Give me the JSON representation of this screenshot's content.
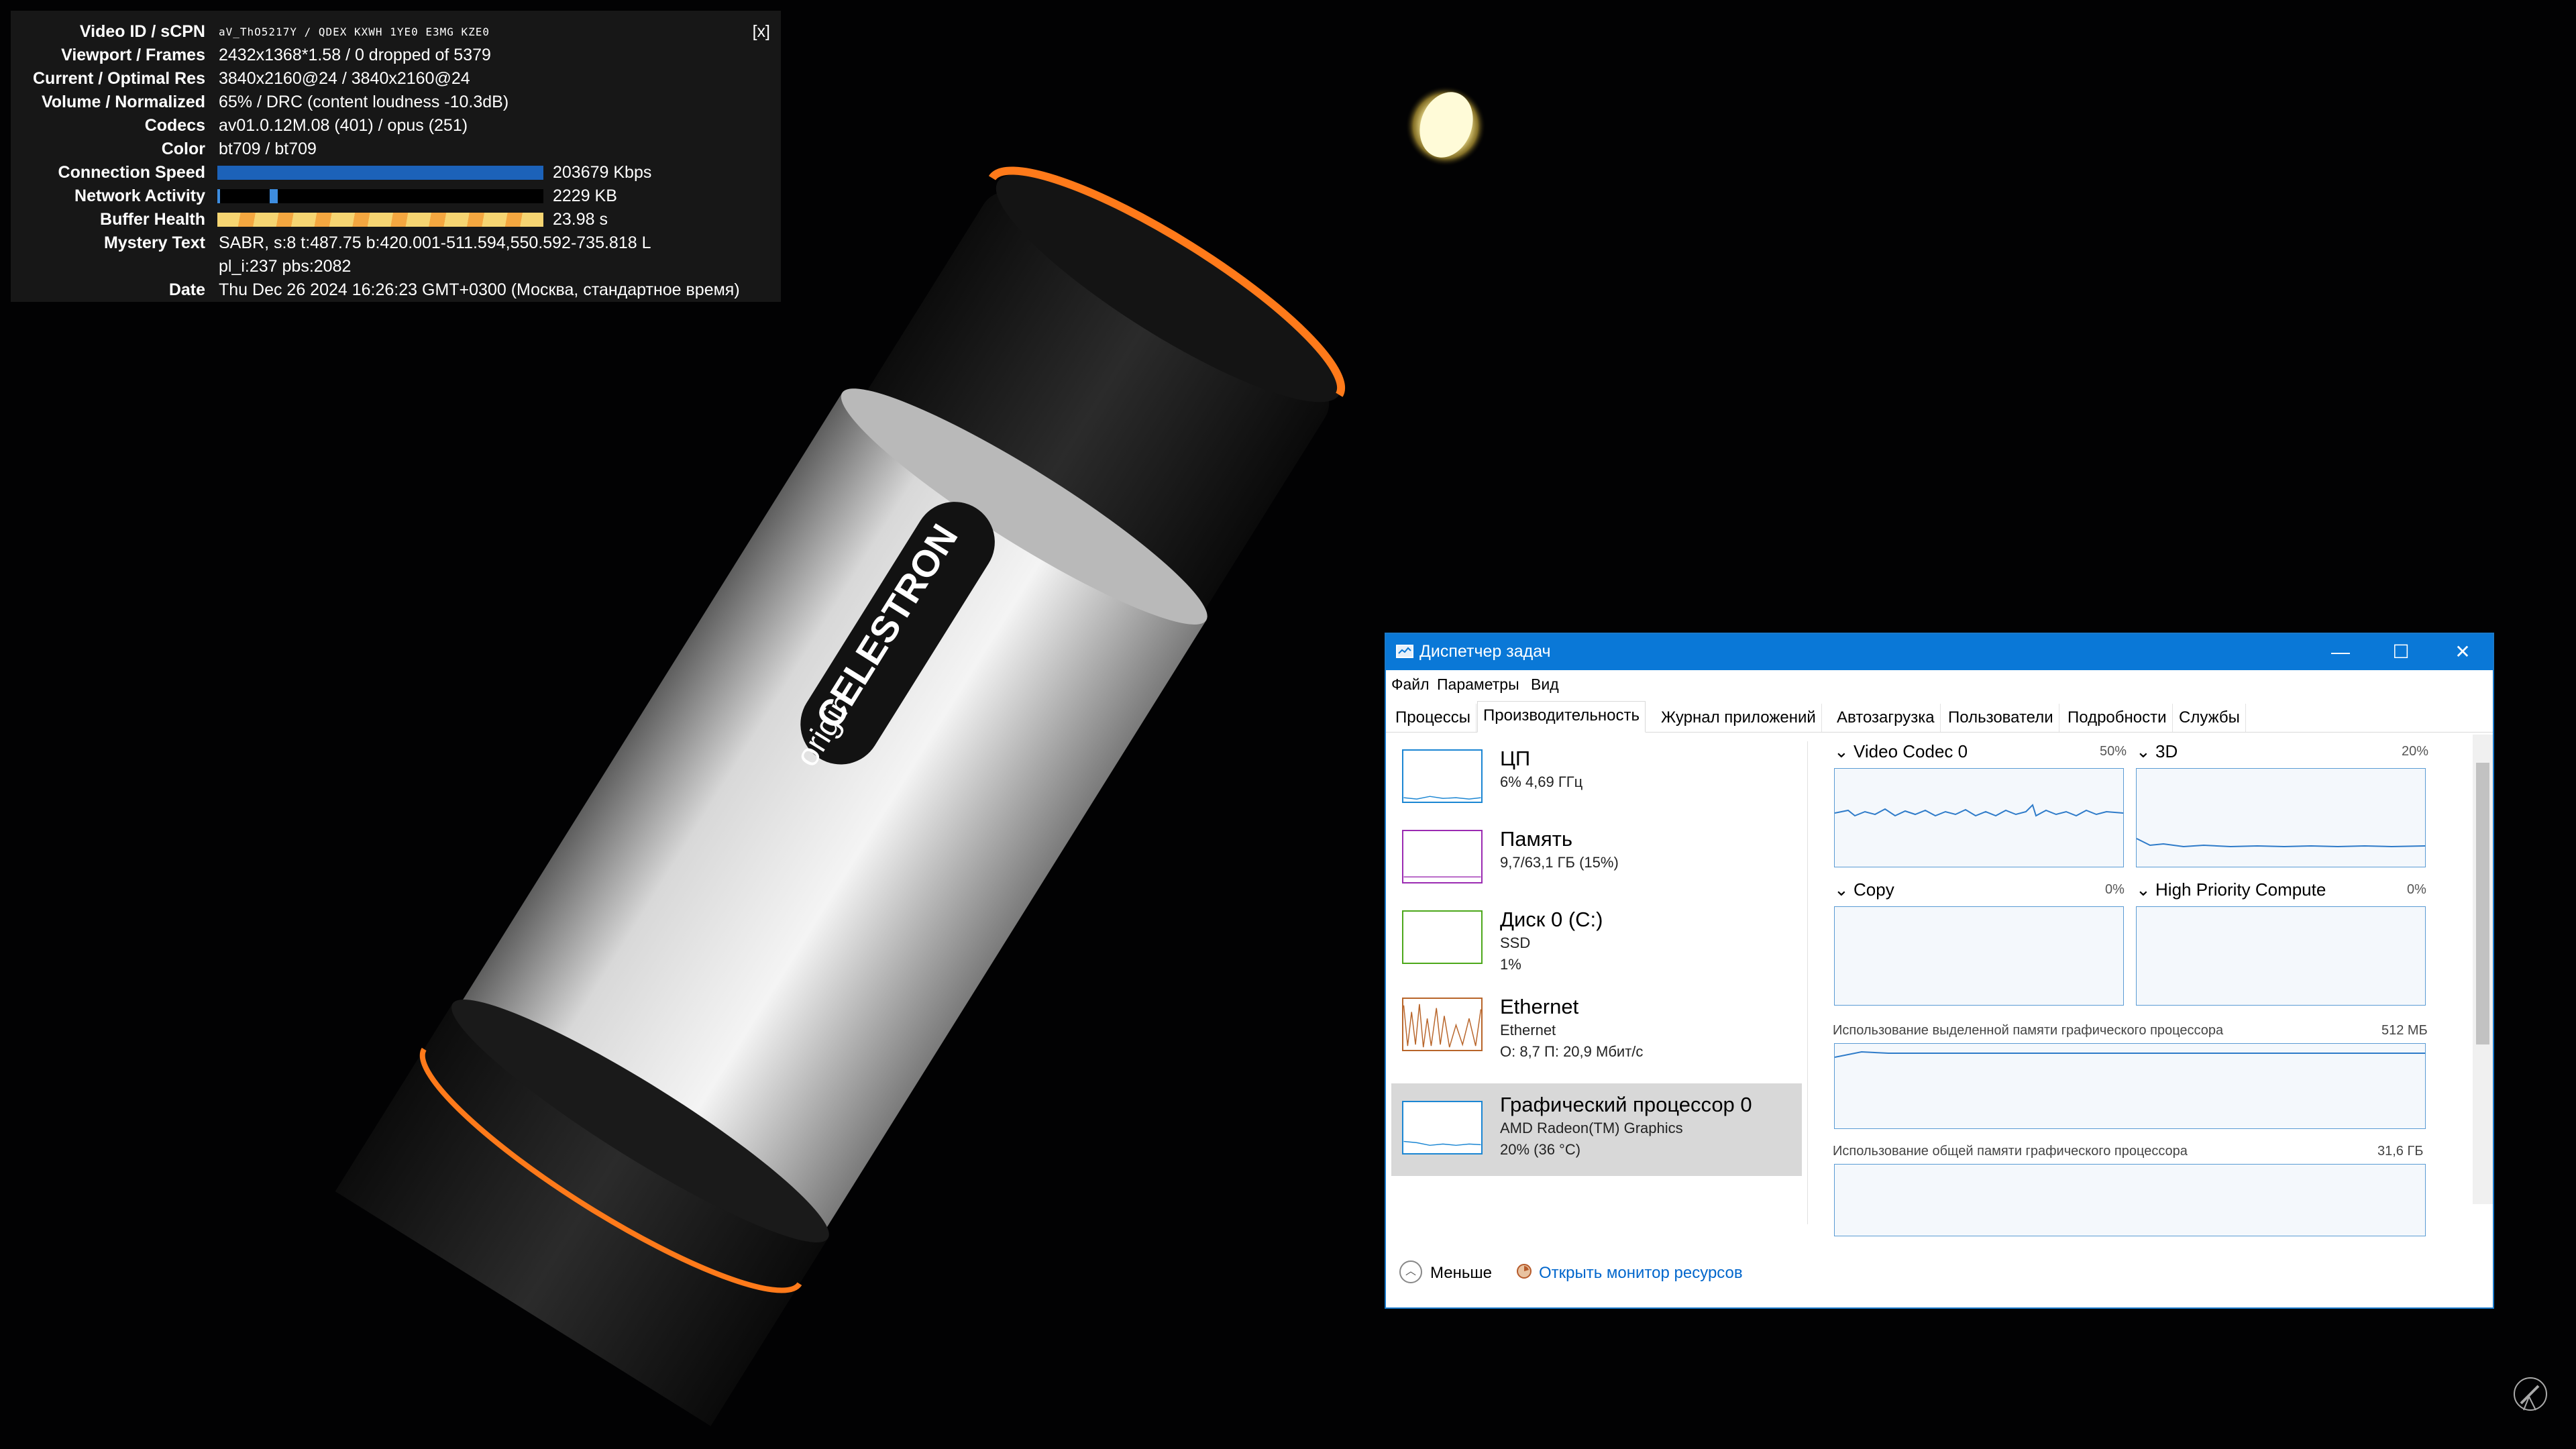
{
  "stats": {
    "rows": [
      {
        "label": "Video ID / sCPN",
        "value": "aV_ThO5217Y / QDEX KXWH 1YE0 E3MG KZE0"
      },
      {
        "label": "Viewport / Frames",
        "value": "2432x1368*1.58 / 0 dropped of 5379"
      },
      {
        "label": "Current / Optimal Res",
        "value": "3840x2160@24 / 3840x2160@24"
      },
      {
        "label": "Volume / Normalized",
        "value": "65% / DRC (content loudness -10.3dB)"
      },
      {
        "label": "Codecs",
        "value": "av01.0.12M.08 (401) / opus (251)"
      },
      {
        "label": "Color",
        "value": "bt709 / bt709"
      },
      {
        "label": "Connection Speed",
        "value": "203679 Kbps"
      },
      {
        "label": "Network Activity",
        "value": "2229 KB"
      },
      {
        "label": "Buffer Health",
        "value": "23.98 s"
      },
      {
        "label": "Mystery Text",
        "value": "SABR, s:8 t:487.75 b:420.001-511.594,550.592-735.818 L"
      },
      {
        "label": "",
        "value": "pl_i:237 pbs:2082"
      },
      {
        "label": "Date",
        "value": "Thu Dec 26 2024 16:26:23 GMT+0300 (Москва, стандартное время)"
      }
    ],
    "close_label": "[x]",
    "connection_fill": 1.0,
    "network_fill": 0.16,
    "buffer_fill": 1.0,
    "colors": {
      "connection": "#1c62b9",
      "network": "#3d8de0",
      "buffer_a": "#f6d572",
      "buffer_b": "#f4a740"
    }
  },
  "taskmgr": {
    "title": "Диспетчер задач",
    "controls": {
      "minimize": "—",
      "maximize": "☐",
      "close": "✕"
    },
    "menu": [
      "Файл",
      "Параметры",
      "Вид"
    ],
    "tabs": [
      "Процессы",
      "Производительность",
      "Журнал приложений",
      "Автозагрузка",
      "Пользователи",
      "Подробности",
      "Службы"
    ],
    "active_tab": "Производительность",
    "resources": [
      {
        "name": "ЦП",
        "sub1": "6%  4,69 ГГц",
        "sub2": "",
        "color": "#1b86d3"
      },
      {
        "name": "Память",
        "sub1": "9,7/63,1 ГБ (15%)",
        "sub2": "",
        "color": "#9b2bb2"
      },
      {
        "name": "Диск 0 (C:)",
        "sub1": "SSD",
        "sub2": "1%",
        "color": "#4da81b"
      },
      {
        "name": "Ethernet",
        "sub1": "Ethernet",
        "sub2": "О: 8,7  П: 20,9 Мбит/с",
        "color": "#b8652a"
      },
      {
        "name": "Графический процессор 0",
        "sub1": "AMD Radeon(TM) Graphics",
        "sub2": "20%  (36 °C)",
        "color": "#1b86d3"
      }
    ],
    "graphs": [
      {
        "title": "Video Codec 0",
        "pct": "50%"
      },
      {
        "title": "3D",
        "pct": "20%"
      },
      {
        "title": "Copy",
        "pct": "0%"
      },
      {
        "title": "High Priority Compute",
        "pct": "0%"
      }
    ],
    "dedicated_mem": {
      "title": "Использование выделенной памяти графического процессора",
      "value": "512 МБ"
    },
    "shared_mem": {
      "title": "Использование общей памяти графического процессора",
      "value": "31,6 ГБ"
    },
    "footer": {
      "less": "Меньше",
      "resmon": "Открыть монитор ресурсов"
    }
  },
  "scene": {
    "brand": "CELESTRON",
    "model": "origin",
    "accent": "#ff7a1a"
  }
}
